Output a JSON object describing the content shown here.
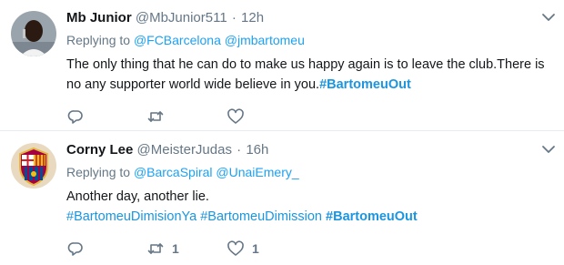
{
  "colors": {
    "link": "#1da1f2",
    "text": "#14171a",
    "muted": "#657786",
    "divider": "#e6ecf0"
  },
  "tweets": [
    {
      "name": "Mb Junior",
      "handle": "@MbJunior511",
      "separator": "·",
      "time": "12h",
      "reply_prefix": "Replying to",
      "reply_to": [
        "@FCBarcelona",
        "@jmbartomeu"
      ],
      "text_line_1": "The only thing that he can do to make us happy again is to leave the club.There is",
      "text_line_2": "no any supporter world wide believe in you.",
      "hashtag": "#BartomeuOut",
      "reply_icon": "reply-icon",
      "retweet_icon": "retweet-icon",
      "like_icon": "heart-icon"
    },
    {
      "name": "Corny Lee",
      "handle": "@MeisterJudas",
      "separator": "·",
      "time": "16h",
      "reply_prefix": "Replying to",
      "reply_to": [
        "@BarcaSpiral",
        "@UnaiEmery_"
      ],
      "text_line_1": "Another day, another lie.",
      "hashtags": [
        "#BartomeuDimisionYa",
        "#BartomeuDimission",
        "#BartomeuOut"
      ],
      "retweet_count": "1",
      "like_count": "1",
      "reply_icon": "reply-icon",
      "retweet_icon": "retweet-icon",
      "like_icon": "heart-icon"
    }
  ]
}
